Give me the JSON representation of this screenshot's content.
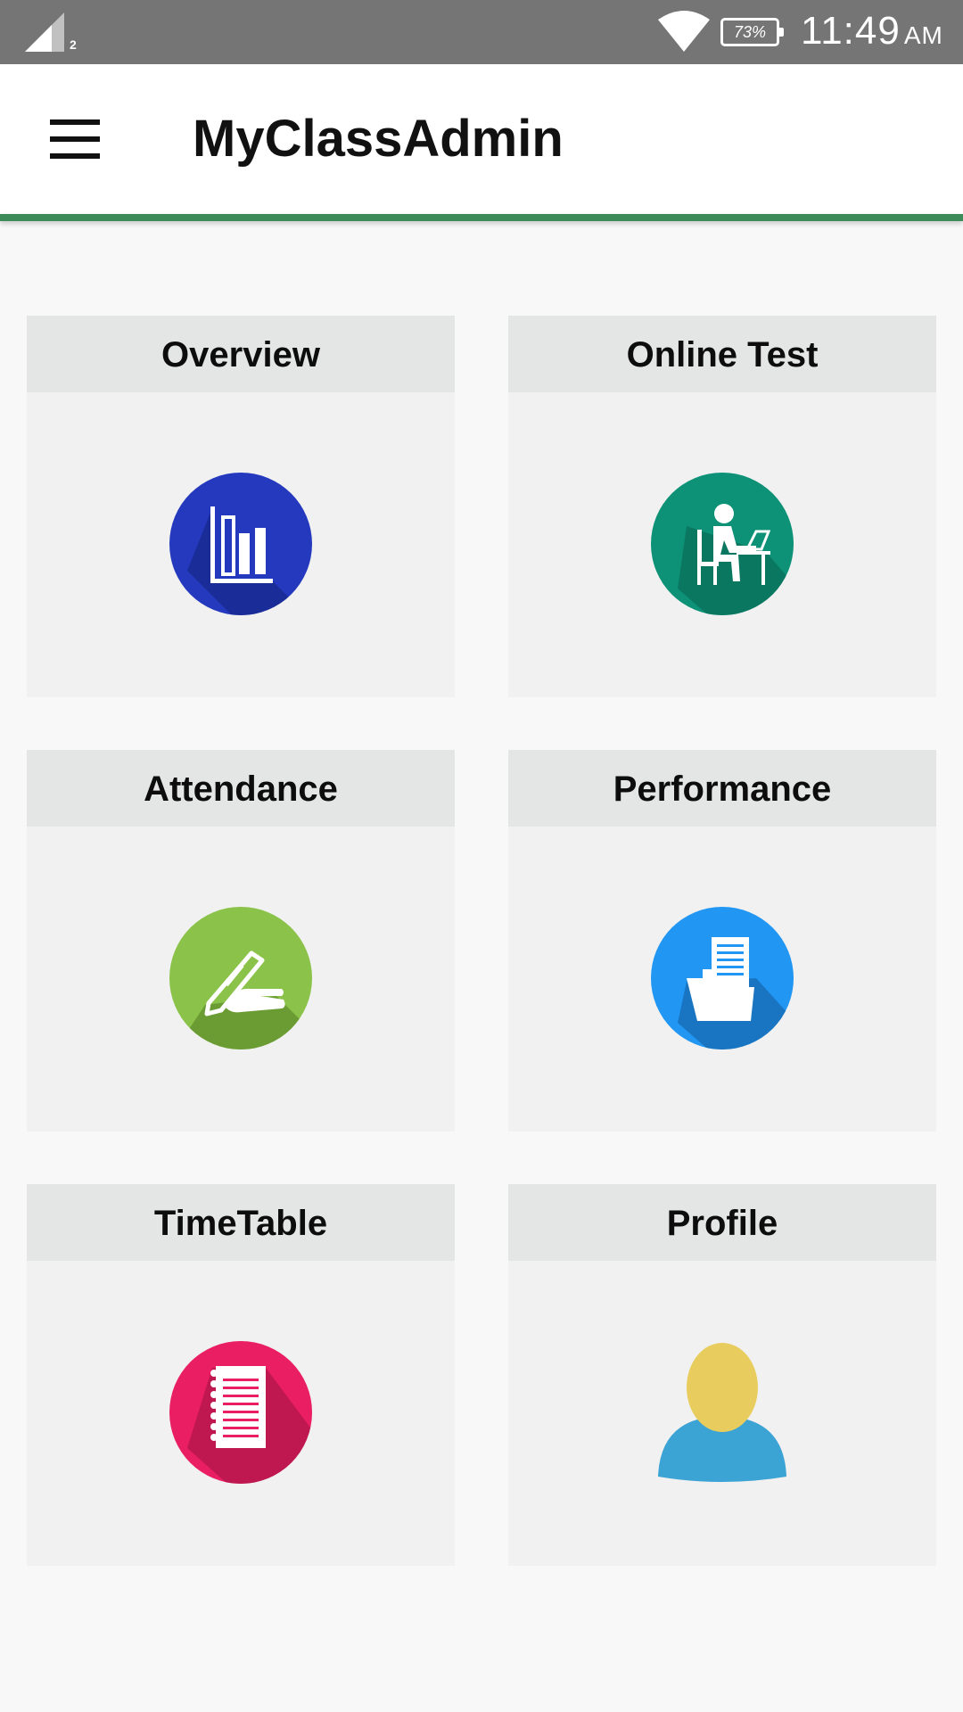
{
  "status_bar": {
    "signal_sub": "2",
    "battery": "73%",
    "time": "11:49",
    "ampm": "AM"
  },
  "app_bar": {
    "title": "MyClassAdmin",
    "accent_color": "#3c8b58",
    "menu_icon": "hamburger-menu-icon"
  },
  "cards": [
    {
      "label": "Overview",
      "icon": "bar-chart-icon",
      "color": "#2439bd"
    },
    {
      "label": "Online Test",
      "icon": "student-at-desk-icon",
      "color": "#0d9277"
    },
    {
      "label": "Attendance",
      "icon": "hand-writing-icon",
      "color": "#8bc34a"
    },
    {
      "label": "Performance",
      "icon": "document-folder-icon",
      "color": "#2196f3"
    },
    {
      "label": "TimeTable",
      "icon": "notebook-icon",
      "color": "#e91e63"
    },
    {
      "label": "Profile",
      "icon": "user-avatar-icon",
      "color": "#3ca3d5"
    }
  ]
}
